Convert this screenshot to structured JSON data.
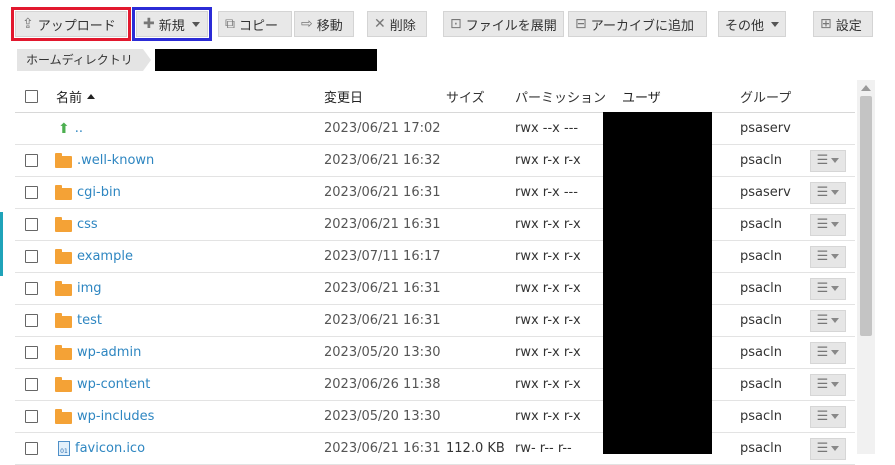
{
  "toolbar": {
    "upload": "アップロード",
    "new": "新規",
    "copy": "コピー",
    "move": "移動",
    "delete": "削除",
    "extract": "ファイルを展開",
    "archive": "アーカイブに追加",
    "other": "その他",
    "settings": "設定"
  },
  "breadcrumb": {
    "home": "ホームディレクトリ"
  },
  "columns": {
    "name": "名前",
    "modified": "変更日",
    "size": "サイズ",
    "permissions": "パーミッション",
    "user": "ユーザ",
    "group": "グループ"
  },
  "rows": [
    {
      "type": "parent",
      "name": "..",
      "date": "2023/06/21 17:02",
      "size": "",
      "perm": "rwx --x ---",
      "group": "psaserv"
    },
    {
      "type": "folder",
      "name": ".well-known",
      "date": "2023/06/21 16:32",
      "size": "",
      "perm": "rwx r-x r-x",
      "group": "psacln"
    },
    {
      "type": "folder",
      "name": "cgi-bin",
      "date": "2023/06/21 16:31",
      "size": "",
      "perm": "rwx r-x ---",
      "group": "psaserv"
    },
    {
      "type": "folder",
      "name": "css",
      "date": "2023/06/21 16:31",
      "size": "",
      "perm": "rwx r-x r-x",
      "group": "psacln"
    },
    {
      "type": "folder",
      "name": "example",
      "date": "2023/07/11 16:17",
      "size": "",
      "perm": "rwx r-x r-x",
      "group": "psacln"
    },
    {
      "type": "folder",
      "name": "img",
      "date": "2023/06/21 16:31",
      "size": "",
      "perm": "rwx r-x r-x",
      "group": "psacln"
    },
    {
      "type": "folder",
      "name": "test",
      "date": "2023/06/21 16:31",
      "size": "",
      "perm": "rwx r-x r-x",
      "group": "psacln"
    },
    {
      "type": "folder",
      "name": "wp-admin",
      "date": "2023/05/20 13:30",
      "size": "",
      "perm": "rwx r-x r-x",
      "group": "psacln"
    },
    {
      "type": "folder",
      "name": "wp-content",
      "date": "2023/06/26 11:38",
      "size": "",
      "perm": "rwx r-x r-x",
      "group": "psacln"
    },
    {
      "type": "folder",
      "name": "wp-includes",
      "date": "2023/05/20 13:30",
      "size": "",
      "perm": "rwx r-x r-x",
      "group": "psacln"
    },
    {
      "type": "file",
      "name": "favicon.ico",
      "date": "2023/06/21 16:31",
      "size": "112.0 KB",
      "perm": "rw- r-- r--",
      "group": "psacln"
    }
  ],
  "icons": {
    "upload": "upload-icon",
    "new": "plus-icon",
    "copy": "copy-icon",
    "move": "arrow-right-icon",
    "delete": "x-icon",
    "extract": "extract-icon",
    "archive": "archive-icon",
    "settings": "settings-icon"
  },
  "colors": {
    "link": "#2e86c1",
    "folder": "#f4a236",
    "upload_highlight": "#e2182e",
    "new_highlight": "#2b2bd6"
  }
}
